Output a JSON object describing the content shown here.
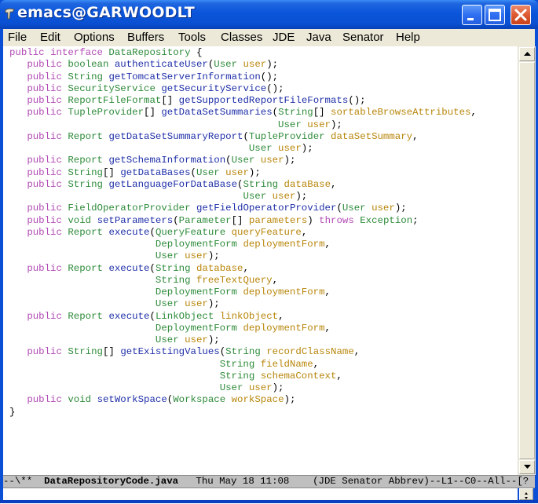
{
  "window": {
    "title": "emacs@GARWOODLT",
    "icon": "emacs-gnu-icon",
    "controls": [
      "minimize",
      "maximize",
      "close"
    ]
  },
  "menubar": {
    "items": [
      "File",
      "Edit",
      "Options",
      "Buffers",
      "Tools",
      "Classes",
      "JDE",
      "Java",
      "Senator",
      "Help"
    ]
  },
  "colors": {
    "keyword": "#b24ab5",
    "type": "#2e8b3a",
    "function": "#1f2fa8",
    "parameter": "#b8860b",
    "titlebar": "#0a55da",
    "menubar": "#ece9d8",
    "modeline": "#bfbfbf"
  },
  "buffer": {
    "lines": [
      [
        [
          "kw",
          "public"
        ],
        [
          "pn",
          " "
        ],
        [
          "kw",
          "interface"
        ],
        [
          "pn",
          " "
        ],
        [
          "ty",
          "DataRepository"
        ],
        [
          "pn",
          " {"
        ]
      ],
      [
        [
          "pn",
          "   "
        ],
        [
          "kw",
          "public"
        ],
        [
          "pn",
          " "
        ],
        [
          "ty",
          "boolean"
        ],
        [
          "pn",
          " "
        ],
        [
          "fn",
          "authenticateUser"
        ],
        [
          "pn",
          "("
        ],
        [
          "ty",
          "User"
        ],
        [
          "pn",
          " "
        ],
        [
          "pa",
          "user"
        ],
        [
          "pn",
          ");"
        ]
      ],
      [
        [
          "pn",
          "   "
        ],
        [
          "kw",
          "public"
        ],
        [
          "pn",
          " "
        ],
        [
          "ty",
          "String"
        ],
        [
          "pn",
          " "
        ],
        [
          "fn",
          "getTomcatServerInformation"
        ],
        [
          "pn",
          "();"
        ]
      ],
      [
        [
          "pn",
          "   "
        ],
        [
          "kw",
          "public"
        ],
        [
          "pn",
          " "
        ],
        [
          "ty",
          "SecurityService"
        ],
        [
          "pn",
          " "
        ],
        [
          "fn",
          "getSecurityService"
        ],
        [
          "pn",
          "();"
        ]
      ],
      [
        [
          "pn",
          "   "
        ],
        [
          "kw",
          "public"
        ],
        [
          "pn",
          " "
        ],
        [
          "ty",
          "ReportFileFormat"
        ],
        [
          "pn",
          "[] "
        ],
        [
          "fn",
          "getSupportedReportFileFormats"
        ],
        [
          "pn",
          "();"
        ]
      ],
      [
        [
          "pn",
          "   "
        ],
        [
          "kw",
          "public"
        ],
        [
          "pn",
          " "
        ],
        [
          "ty",
          "TupleProvider"
        ],
        [
          "pn",
          "[] "
        ],
        [
          "fn",
          "getDataSetSummaries"
        ],
        [
          "pn",
          "("
        ],
        [
          "ty",
          "String"
        ],
        [
          "pn",
          "[] "
        ],
        [
          "pa",
          "sortableBrowseAttributes"
        ],
        [
          "pn",
          ","
        ]
      ],
      [
        [
          "pn",
          "                                              "
        ],
        [
          "ty",
          "User"
        ],
        [
          "pn",
          " "
        ],
        [
          "pa",
          "user"
        ],
        [
          "pn",
          ");"
        ]
      ],
      [
        [
          "pn",
          "   "
        ],
        [
          "kw",
          "public"
        ],
        [
          "pn",
          " "
        ],
        [
          "ty",
          "Report"
        ],
        [
          "pn",
          " "
        ],
        [
          "fn",
          "getDataSetSummaryReport"
        ],
        [
          "pn",
          "("
        ],
        [
          "ty",
          "TupleProvider"
        ],
        [
          "pn",
          " "
        ],
        [
          "pa",
          "dataSetSummary"
        ],
        [
          "pn",
          ","
        ]
      ],
      [
        [
          "pn",
          "                                         "
        ],
        [
          "ty",
          "User"
        ],
        [
          "pn",
          " "
        ],
        [
          "pa",
          "user"
        ],
        [
          "pn",
          ");"
        ]
      ],
      [
        [
          "pn",
          "   "
        ],
        [
          "kw",
          "public"
        ],
        [
          "pn",
          " "
        ],
        [
          "ty",
          "Report"
        ],
        [
          "pn",
          " "
        ],
        [
          "fn",
          "getSchemaInformation"
        ],
        [
          "pn",
          "("
        ],
        [
          "ty",
          "User"
        ],
        [
          "pn",
          " "
        ],
        [
          "pa",
          "user"
        ],
        [
          "pn",
          ");"
        ]
      ],
      [
        [
          "pn",
          "   "
        ],
        [
          "kw",
          "public"
        ],
        [
          "pn",
          " "
        ],
        [
          "ty",
          "String"
        ],
        [
          "pn",
          "[] "
        ],
        [
          "fn",
          "getDataBases"
        ],
        [
          "pn",
          "("
        ],
        [
          "ty",
          "User"
        ],
        [
          "pn",
          " "
        ],
        [
          "pa",
          "user"
        ],
        [
          "pn",
          ");"
        ]
      ],
      [
        [
          "pn",
          "   "
        ],
        [
          "kw",
          "public"
        ],
        [
          "pn",
          " "
        ],
        [
          "ty",
          "String"
        ],
        [
          "pn",
          " "
        ],
        [
          "fn",
          "getLanguageForDataBase"
        ],
        [
          "pn",
          "("
        ],
        [
          "ty",
          "String"
        ],
        [
          "pn",
          " "
        ],
        [
          "pa",
          "dataBase"
        ],
        [
          "pn",
          ","
        ]
      ],
      [
        [
          "pn",
          "                                        "
        ],
        [
          "ty",
          "User"
        ],
        [
          "pn",
          " "
        ],
        [
          "pa",
          "user"
        ],
        [
          "pn",
          ");"
        ]
      ],
      [
        [
          "pn",
          "   "
        ],
        [
          "kw",
          "public"
        ],
        [
          "pn",
          " "
        ],
        [
          "ty",
          "FieldOperatorProvider"
        ],
        [
          "pn",
          " "
        ],
        [
          "fn",
          "getFieldOperatorProvider"
        ],
        [
          "pn",
          "("
        ],
        [
          "ty",
          "User"
        ],
        [
          "pn",
          " "
        ],
        [
          "pa",
          "user"
        ],
        [
          "pn",
          ");"
        ]
      ],
      [
        [
          "pn",
          "   "
        ],
        [
          "kw",
          "public"
        ],
        [
          "pn",
          " "
        ],
        [
          "ty",
          "void"
        ],
        [
          "pn",
          " "
        ],
        [
          "fn",
          "setParameters"
        ],
        [
          "pn",
          "("
        ],
        [
          "ty",
          "Parameter"
        ],
        [
          "pn",
          "[] "
        ],
        [
          "pa",
          "parameters"
        ],
        [
          "pn",
          ") "
        ],
        [
          "kw",
          "throws"
        ],
        [
          "pn",
          " "
        ],
        [
          "ty",
          "Exception"
        ],
        [
          "pn",
          ";"
        ]
      ],
      [
        [
          "pn",
          "   "
        ],
        [
          "kw",
          "public"
        ],
        [
          "pn",
          " "
        ],
        [
          "ty",
          "Report"
        ],
        [
          "pn",
          " "
        ],
        [
          "fn",
          "execute"
        ],
        [
          "pn",
          "("
        ],
        [
          "ty",
          "QueryFeature"
        ],
        [
          "pn",
          " "
        ],
        [
          "pa",
          "queryFeature"
        ],
        [
          "pn",
          ","
        ]
      ],
      [
        [
          "pn",
          "                         "
        ],
        [
          "ty",
          "DeploymentForm"
        ],
        [
          "pn",
          " "
        ],
        [
          "pa",
          "deploymentForm"
        ],
        [
          "pn",
          ","
        ]
      ],
      [
        [
          "pn",
          "                         "
        ],
        [
          "ty",
          "User"
        ],
        [
          "pn",
          " "
        ],
        [
          "pa",
          "user"
        ],
        [
          "pn",
          ");"
        ]
      ],
      [
        [
          "pn",
          "   "
        ],
        [
          "kw",
          "public"
        ],
        [
          "pn",
          " "
        ],
        [
          "ty",
          "Report"
        ],
        [
          "pn",
          " "
        ],
        [
          "fn",
          "execute"
        ],
        [
          "pn",
          "("
        ],
        [
          "ty",
          "String"
        ],
        [
          "pn",
          " "
        ],
        [
          "pa",
          "database"
        ],
        [
          "pn",
          ","
        ]
      ],
      [
        [
          "pn",
          "                         "
        ],
        [
          "ty",
          "String"
        ],
        [
          "pn",
          " "
        ],
        [
          "pa",
          "freeTextQuery"
        ],
        [
          "pn",
          ","
        ]
      ],
      [
        [
          "pn",
          "                         "
        ],
        [
          "ty",
          "DeploymentForm"
        ],
        [
          "pn",
          " "
        ],
        [
          "pa",
          "deploymentForm"
        ],
        [
          "pn",
          ","
        ]
      ],
      [
        [
          "pn",
          "                         "
        ],
        [
          "ty",
          "User"
        ],
        [
          "pn",
          " "
        ],
        [
          "pa",
          "user"
        ],
        [
          "pn",
          ");"
        ]
      ],
      [
        [
          "pn",
          "   "
        ],
        [
          "kw",
          "public"
        ],
        [
          "pn",
          " "
        ],
        [
          "ty",
          "Report"
        ],
        [
          "pn",
          " "
        ],
        [
          "fn",
          "execute"
        ],
        [
          "pn",
          "("
        ],
        [
          "ty",
          "LinkObject"
        ],
        [
          "pn",
          " "
        ],
        [
          "pa",
          "linkObject"
        ],
        [
          "pn",
          ","
        ]
      ],
      [
        [
          "pn",
          "                         "
        ],
        [
          "ty",
          "DeploymentForm"
        ],
        [
          "pn",
          " "
        ],
        [
          "pa",
          "deploymentForm"
        ],
        [
          "pn",
          ","
        ]
      ],
      [
        [
          "pn",
          "                         "
        ],
        [
          "ty",
          "User"
        ],
        [
          "pn",
          " "
        ],
        [
          "pa",
          "user"
        ],
        [
          "pn",
          ");"
        ]
      ],
      [
        [
          "pn",
          "   "
        ],
        [
          "kw",
          "public"
        ],
        [
          "pn",
          " "
        ],
        [
          "ty",
          "String"
        ],
        [
          "pn",
          "[] "
        ],
        [
          "fn",
          "getExistingValues"
        ],
        [
          "pn",
          "("
        ],
        [
          "ty",
          "String"
        ],
        [
          "pn",
          " "
        ],
        [
          "pa",
          "recordClassName"
        ],
        [
          "pn",
          ","
        ]
      ],
      [
        [
          "pn",
          "                                    "
        ],
        [
          "ty",
          "String"
        ],
        [
          "pn",
          " "
        ],
        [
          "pa",
          "fieldName"
        ],
        [
          "pn",
          ","
        ]
      ],
      [
        [
          "pn",
          "                                    "
        ],
        [
          "ty",
          "String"
        ],
        [
          "pn",
          " "
        ],
        [
          "pa",
          "schemaContext"
        ],
        [
          "pn",
          ","
        ]
      ],
      [
        [
          "pn",
          "                                    "
        ],
        [
          "ty",
          "User"
        ],
        [
          "pn",
          " "
        ],
        [
          "pa",
          "user"
        ],
        [
          "pn",
          ");"
        ]
      ],
      [
        [
          "pn",
          "   "
        ],
        [
          "kw",
          "public"
        ],
        [
          "pn",
          " "
        ],
        [
          "ty",
          "void"
        ],
        [
          "pn",
          " "
        ],
        [
          "fn",
          "setWorkSpace"
        ],
        [
          "pn",
          "("
        ],
        [
          "ty",
          "Workspace"
        ],
        [
          "pn",
          " "
        ],
        [
          "pa",
          "workSpace"
        ],
        [
          "pn",
          ");"
        ]
      ],
      [
        [
          "pn",
          "}"
        ]
      ]
    ]
  },
  "modeline": {
    "prefix": "--\\**  ",
    "buffer_name": "DataRepositoryCode.java",
    "time": "   Thu May 18 11:08    ",
    "modes": "(JDE Senator Abbrev)--L1--C0--All--[?"
  },
  "scrollbar": {
    "position": "All"
  }
}
